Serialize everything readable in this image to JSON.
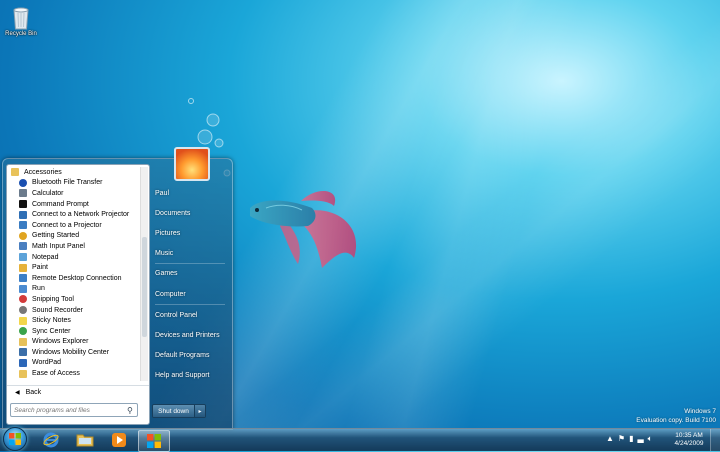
{
  "desktop": {
    "recycle_bin_label": "Recycle Bin",
    "watermark_line1": "Windows 7",
    "watermark_line2": "Evaluation copy. Build 7100"
  },
  "start_menu": {
    "programs_header": "Accessories",
    "programs": [
      {
        "label": "Bluetooth File Transfer",
        "icon": "bluetooth-icon",
        "color": "#1a4fb0"
      },
      {
        "label": "Calculator",
        "icon": "calculator-icon",
        "color": "#6b7b8c"
      },
      {
        "label": "Command Prompt",
        "icon": "command-prompt-icon",
        "color": "#111111"
      },
      {
        "label": "Connect to a Network Projector",
        "icon": "network-projector-icon",
        "color": "#2f6fb5"
      },
      {
        "label": "Connect to a Projector",
        "icon": "projector-icon",
        "color": "#3a7cc2"
      },
      {
        "label": "Getting Started",
        "icon": "getting-started-icon",
        "color": "#e0a420"
      },
      {
        "label": "Math Input Panel",
        "icon": "math-input-icon",
        "color": "#4a7fc0"
      },
      {
        "label": "Notepad",
        "icon": "notepad-icon",
        "color": "#5da3d9"
      },
      {
        "label": "Paint",
        "icon": "paint-icon",
        "color": "#e6b23a"
      },
      {
        "label": "Remote Desktop Connection",
        "icon": "remote-desktop-icon",
        "color": "#3b7fc7"
      },
      {
        "label": "Run",
        "icon": "run-icon",
        "color": "#4b8bd0"
      },
      {
        "label": "Snipping Tool",
        "icon": "snipping-tool-icon",
        "color": "#d23b3b"
      },
      {
        "label": "Sound Recorder",
        "icon": "sound-recorder-icon",
        "color": "#777777"
      },
      {
        "label": "Sticky Notes",
        "icon": "sticky-notes-icon",
        "color": "#f2d64b"
      },
      {
        "label": "Sync Center",
        "icon": "sync-center-icon",
        "color": "#3aa34a"
      },
      {
        "label": "Windows Explorer",
        "icon": "windows-explorer-icon",
        "color": "#e6c15a"
      },
      {
        "label": "Windows Mobility Center",
        "icon": "mobility-center-icon",
        "color": "#3c6fa8"
      },
      {
        "label": "WordPad",
        "icon": "wordpad-icon",
        "color": "#2c67b8"
      },
      {
        "label": "Ease of Access",
        "icon": "folder-icon",
        "color": "#e8c25a"
      }
    ],
    "back_label": "Back",
    "search_placeholder": "Search programs and files",
    "right_items": [
      "Paul",
      "Documents",
      "Pictures",
      "Music",
      "Games",
      "Computer",
      "Control Panel",
      "Devices and Printers",
      "Default Programs",
      "Help and Support"
    ],
    "shutdown_label": "Shut down"
  },
  "taskbar": {
    "clock_time": "10:35 AM",
    "clock_date": "4/24/2009"
  }
}
